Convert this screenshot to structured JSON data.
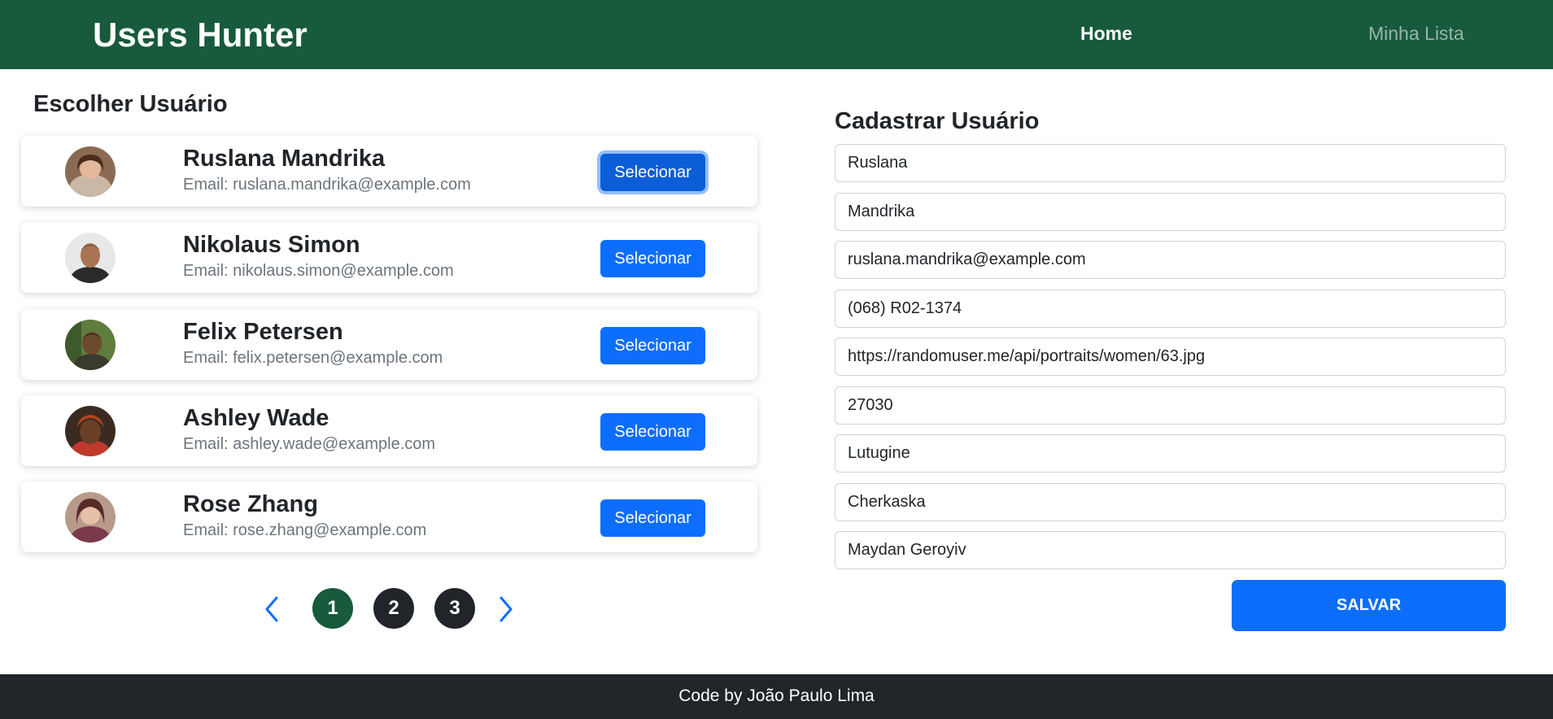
{
  "navbar": {
    "brand": "Users Hunter",
    "links": [
      {
        "label": "Home",
        "active": true
      },
      {
        "label": "Minha Lista",
        "active": false
      }
    ]
  },
  "left_panel": {
    "title": "Escolher Usuário",
    "users": [
      {
        "name": "Ruslana Mandrika",
        "email": "Email: ruslana.mandrika@example.com",
        "button": "Selecionar",
        "focused": true
      },
      {
        "name": "Nikolaus Simon",
        "email": "Email: nikolaus.simon@example.com",
        "button": "Selecionar",
        "focused": false
      },
      {
        "name": "Felix Petersen",
        "email": "Email: felix.petersen@example.com",
        "button": "Selecionar",
        "focused": false
      },
      {
        "name": "Ashley Wade",
        "email": "Email: ashley.wade@example.com",
        "button": "Selecionar",
        "focused": false
      },
      {
        "name": "Rose Zhang",
        "email": "Email: rose.zhang@example.com",
        "button": "Selecionar",
        "focused": false
      }
    ],
    "pagination": {
      "pages": [
        "1",
        "2",
        "3"
      ],
      "current": "1",
      "prev_icon": "chevron-left-icon",
      "next_icon": "chevron-right-icon"
    }
  },
  "right_panel": {
    "title": "Cadastrar Usuário",
    "fields": [
      "Ruslana",
      "Mandrika",
      "ruslana.mandrika@example.com",
      "(068) R02-1374",
      "https://randomuser.me/api/portraits/women/63.jpg",
      "27030",
      "Lutugine",
      "Cherkaska",
      "Maydan Geroyiv"
    ],
    "save_label": "SALVAR"
  },
  "footer": {
    "text": "Code by João Paulo Lima"
  },
  "colors": {
    "navbar_bg": "#185a3c",
    "primary": "#0d6efd",
    "footer_bg": "#212529",
    "page_active": "#185a3c",
    "page_inactive": "#212529"
  }
}
